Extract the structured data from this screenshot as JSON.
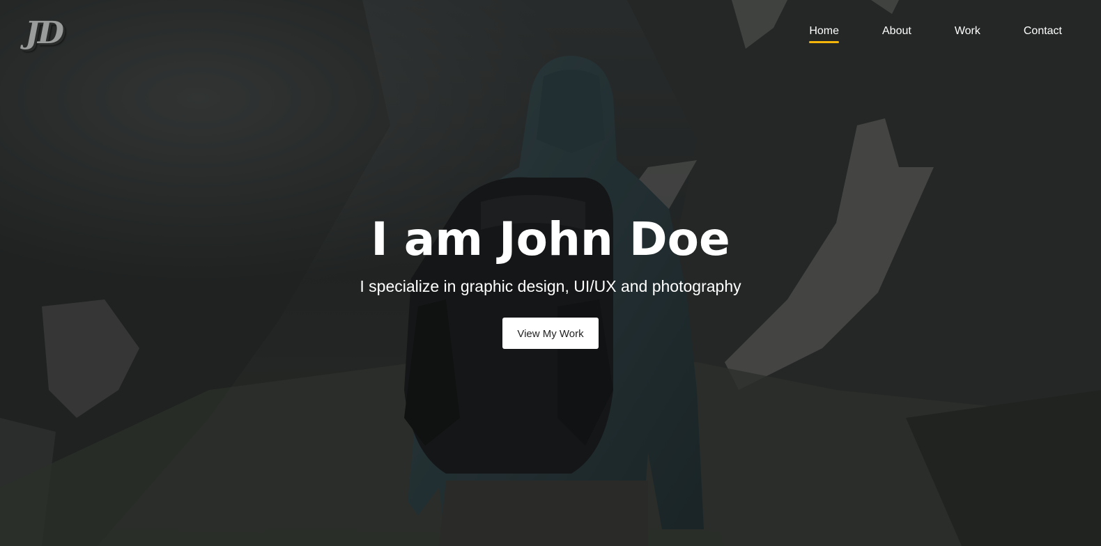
{
  "logo": {
    "text": "JD"
  },
  "nav": {
    "items": [
      {
        "label": "Home",
        "active": true
      },
      {
        "label": "About",
        "active": false
      },
      {
        "label": "Work",
        "active": false
      },
      {
        "label": "Contact",
        "active": false
      }
    ]
  },
  "hero": {
    "title": "I am John Doe",
    "subtitle": "I specialize in graphic design, UI/UX and photography",
    "cta_label": "View My Work"
  },
  "colors": {
    "accent": "#f5b50a",
    "overlay": "#0a0c0c",
    "text": "#ffffff",
    "button_bg": "#ffffff",
    "button_text": "#222222"
  }
}
